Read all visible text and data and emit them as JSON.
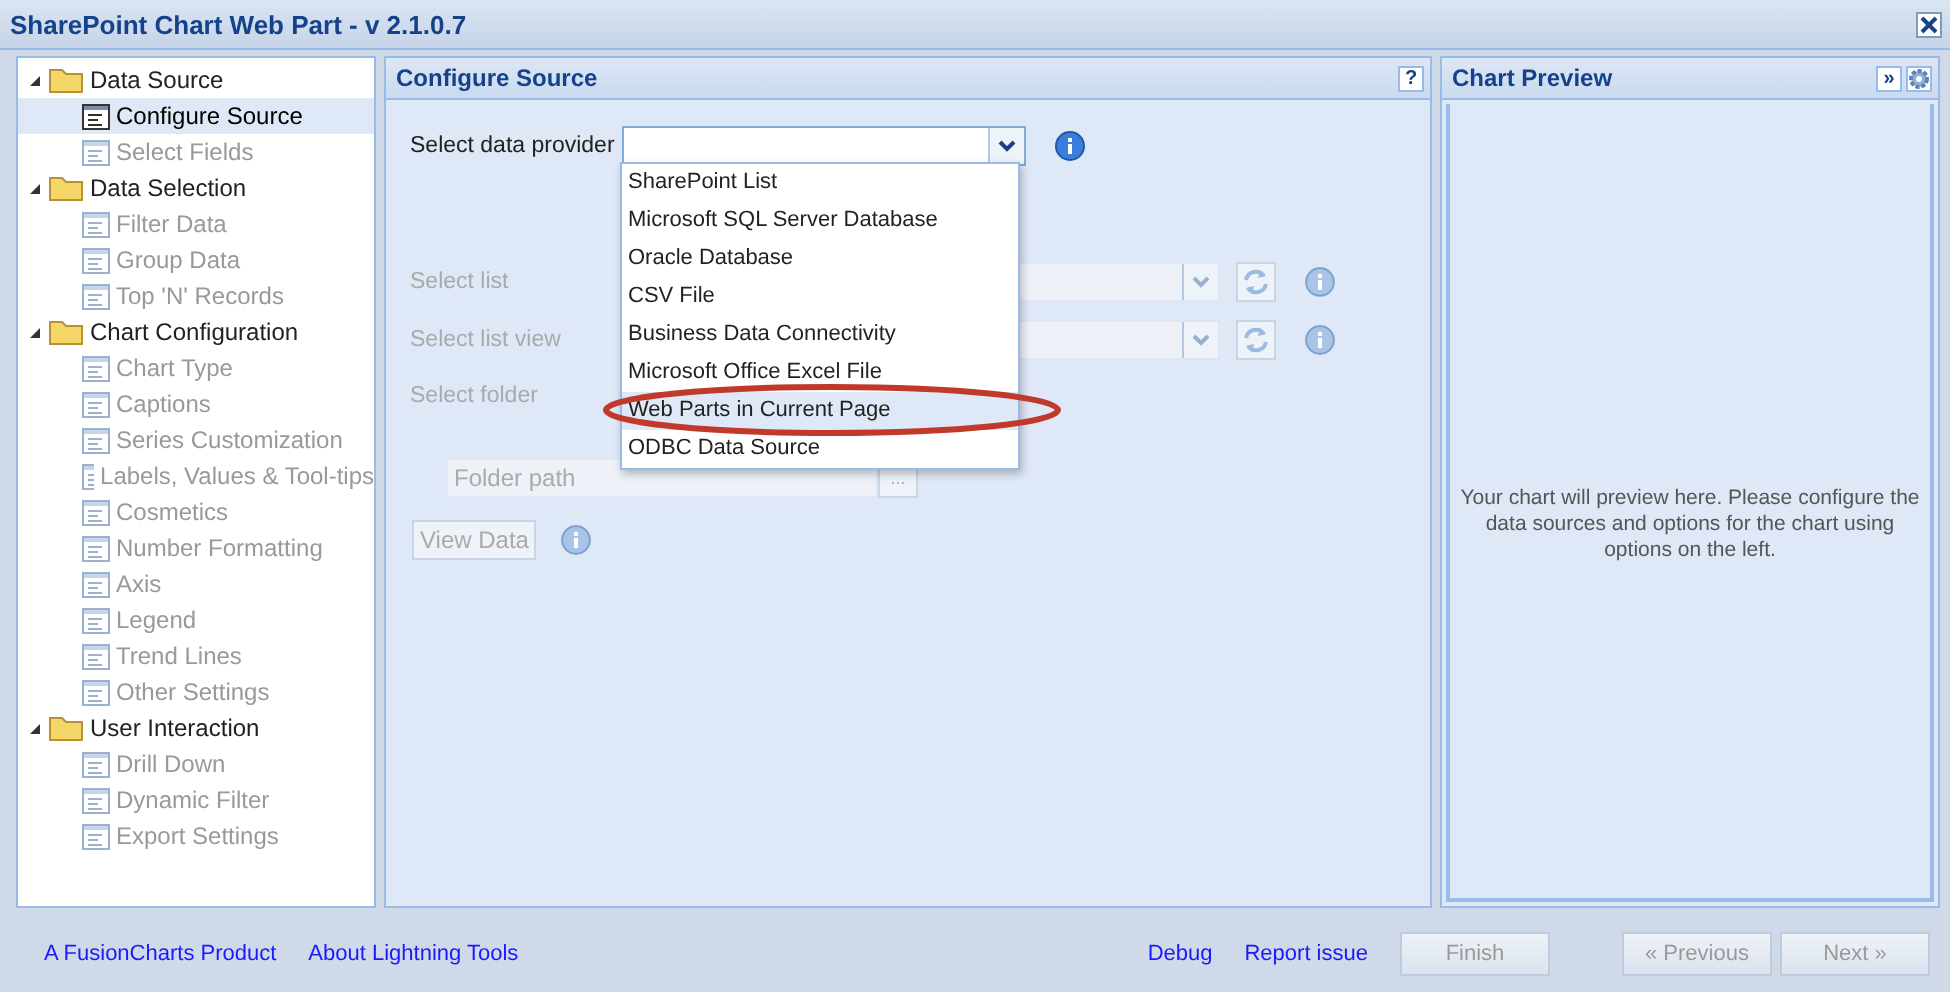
{
  "window": {
    "title": "SharePoint Chart Web Part - v 2.1.0.7"
  },
  "sidebar": {
    "groups": [
      {
        "label": "Data Source",
        "expanded": true,
        "children": [
          {
            "label": "Configure Source",
            "selected": true,
            "disabled": false
          },
          {
            "label": "Select Fields",
            "selected": false,
            "disabled": true
          }
        ]
      },
      {
        "label": "Data Selection",
        "expanded": true,
        "children": [
          {
            "label": "Filter Data",
            "selected": false,
            "disabled": true
          },
          {
            "label": "Group Data",
            "selected": false,
            "disabled": true
          },
          {
            "label": "Top 'N' Records",
            "selected": false,
            "disabled": true
          }
        ]
      },
      {
        "label": "Chart Configuration",
        "expanded": true,
        "children": [
          {
            "label": "Chart Type",
            "selected": false,
            "disabled": true
          },
          {
            "label": "Captions",
            "selected": false,
            "disabled": true
          },
          {
            "label": "Series Customization",
            "selected": false,
            "disabled": true
          },
          {
            "label": "Labels, Values & Tool-tips",
            "selected": false,
            "disabled": true
          },
          {
            "label": "Cosmetics",
            "selected": false,
            "disabled": true
          },
          {
            "label": "Number Formatting",
            "selected": false,
            "disabled": true
          },
          {
            "label": "Axis",
            "selected": false,
            "disabled": true
          },
          {
            "label": "Legend",
            "selected": false,
            "disabled": true
          },
          {
            "label": "Trend Lines",
            "selected": false,
            "disabled": true
          },
          {
            "label": "Other Settings",
            "selected": false,
            "disabled": true
          }
        ]
      },
      {
        "label": "User Interaction",
        "expanded": true,
        "children": [
          {
            "label": "Drill Down",
            "selected": false,
            "disabled": true
          },
          {
            "label": "Dynamic Filter",
            "selected": false,
            "disabled": true
          },
          {
            "label": "Export Settings",
            "selected": false,
            "disabled": true
          }
        ]
      }
    ]
  },
  "configure_panel": {
    "title": "Configure Source",
    "help": "?",
    "provider": {
      "label": "Select data provider",
      "expanded": true,
      "options": [
        {
          "label": "SharePoint List",
          "circled": false
        },
        {
          "label": "Microsoft SQL Server Database",
          "circled": false
        },
        {
          "label": "Oracle Database",
          "circled": false
        },
        {
          "label": "CSV File",
          "circled": false
        },
        {
          "label": "Business Data Connectivity",
          "circled": false
        },
        {
          "label": "Microsoft Office Excel File",
          "circled": false
        },
        {
          "label": "Web Parts in Current Page",
          "circled": true
        },
        {
          "label": "ODBC Data Source",
          "circled": false
        }
      ]
    },
    "fields": [
      {
        "label": "Select list",
        "disabled": true
      },
      {
        "label": "Select list view",
        "disabled": true
      }
    ],
    "folder_label": "Select folder",
    "folder_path": {
      "placeholder": "Folder path",
      "button": "...",
      "disabled": true
    },
    "view_data": {
      "label": "View Data",
      "disabled": true
    }
  },
  "preview_panel": {
    "title": "Chart Preview",
    "expand": "»",
    "message": "Your chart will preview here. Please configure the data sources and options for the chart using options on the left."
  },
  "footer": {
    "links_left": [
      "A FusionCharts Product",
      "About Lightning Tools"
    ],
    "links_right": [
      "Debug",
      "Report issue"
    ],
    "buttons": [
      {
        "label": "Finish",
        "disabled": true
      },
      {
        "label": "« Previous",
        "disabled": true
      },
      {
        "label": "Next »",
        "disabled": true
      }
    ]
  }
}
